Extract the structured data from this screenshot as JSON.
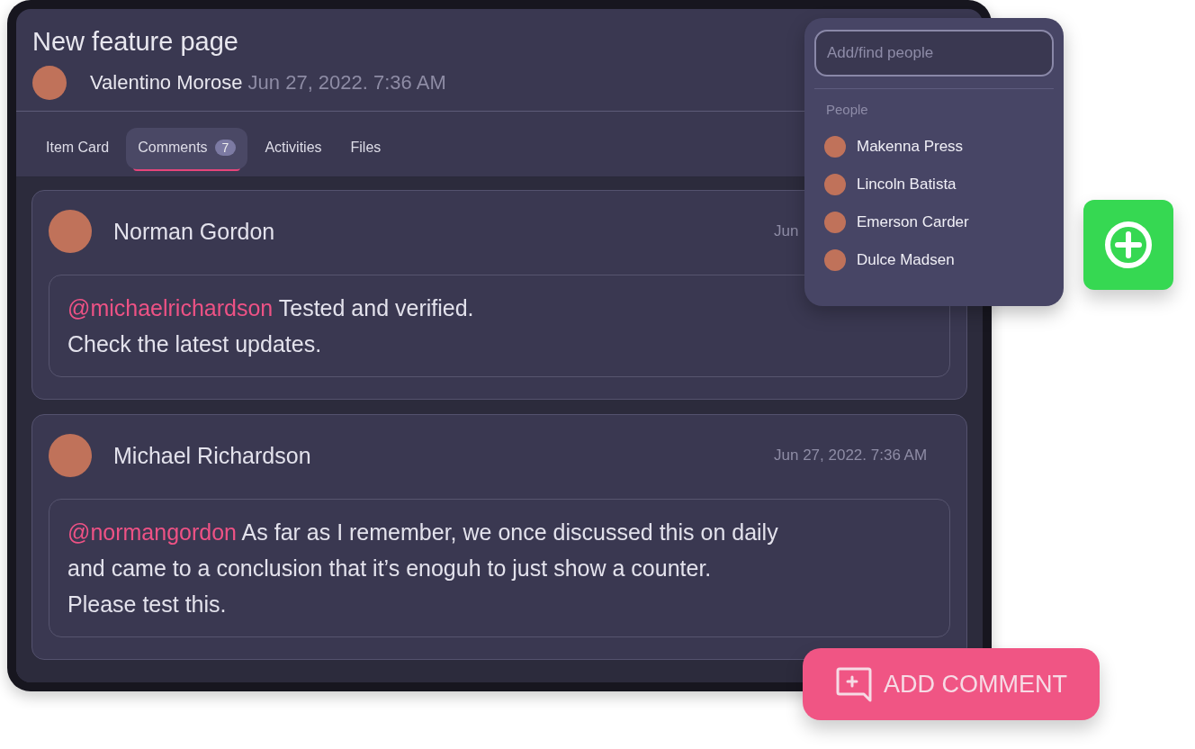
{
  "page": {
    "title": "New feature page",
    "author": {
      "name": "Valentino Morose",
      "time": "Jun 27, 2022. 7:36 AM"
    }
  },
  "tabs": [
    {
      "label": "Item Card",
      "selected": false
    },
    {
      "label": "Comments",
      "count": "7",
      "selected": true
    },
    {
      "label": "Activities",
      "selected": false
    },
    {
      "label": "Files",
      "selected": false
    }
  ],
  "comments": [
    {
      "author": "Norman Gordon",
      "time": "Jun",
      "mention": "@michaelrichardson",
      "text": " Tested and verified.\nCheck the latest updates."
    },
    {
      "author": "Michael Richardson",
      "time": "Jun 27, 2022. 7:36 AM",
      "mention": "@normangordon",
      "text": " As far as I remember, we once discussed this on daily\nand came to a conclusion that it’s enoguh to just show a counter.\nPlease test this."
    }
  ],
  "people_picker": {
    "placeholder": "Add/find people",
    "section": "People",
    "people": [
      {
        "name": "Makenna Press"
      },
      {
        "name": "Lincoln Batista"
      },
      {
        "name": "Emerson Carder"
      },
      {
        "name": "Dulce Madsen"
      }
    ]
  },
  "add_comment_button": {
    "label": "ADD COMMENT"
  }
}
